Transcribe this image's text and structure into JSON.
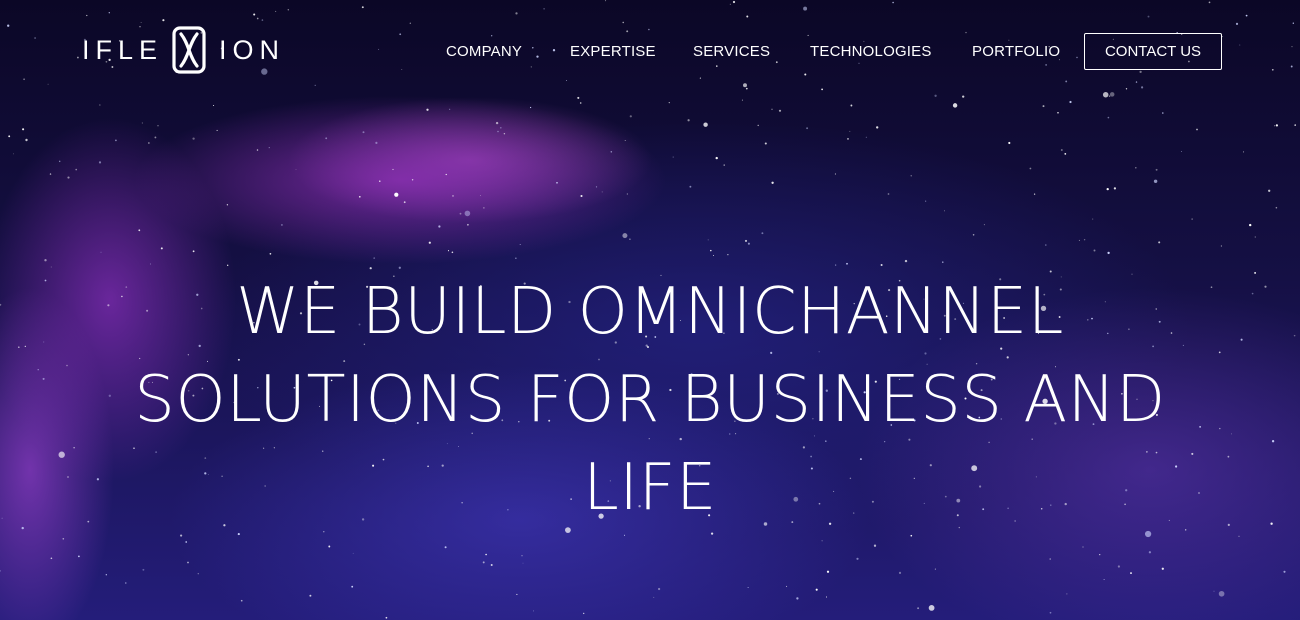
{
  "brand": {
    "name_left": "IFLE",
    "name_right": "ION",
    "mark_icon": "x-loop-logo-mark"
  },
  "nav": {
    "items": [
      {
        "label": "COMPANY"
      },
      {
        "label": "EXPERTISE"
      },
      {
        "label": "SERVICES"
      },
      {
        "label": "TECHNOLOGIES"
      },
      {
        "label": "PORTFOLIO"
      }
    ],
    "contact_label": "CONTACT US"
  },
  "hero": {
    "headline": "WE BUILD OMNICHANNEL SOLUTIONS FOR BUSINESS AND LIFE",
    "background": "purple-galaxy-starfield"
  },
  "colors": {
    "text": "#ffffff",
    "sky_dark": "#0b0726",
    "sky_blue": "#241d7a",
    "nebula_purple": "#9632be"
  }
}
